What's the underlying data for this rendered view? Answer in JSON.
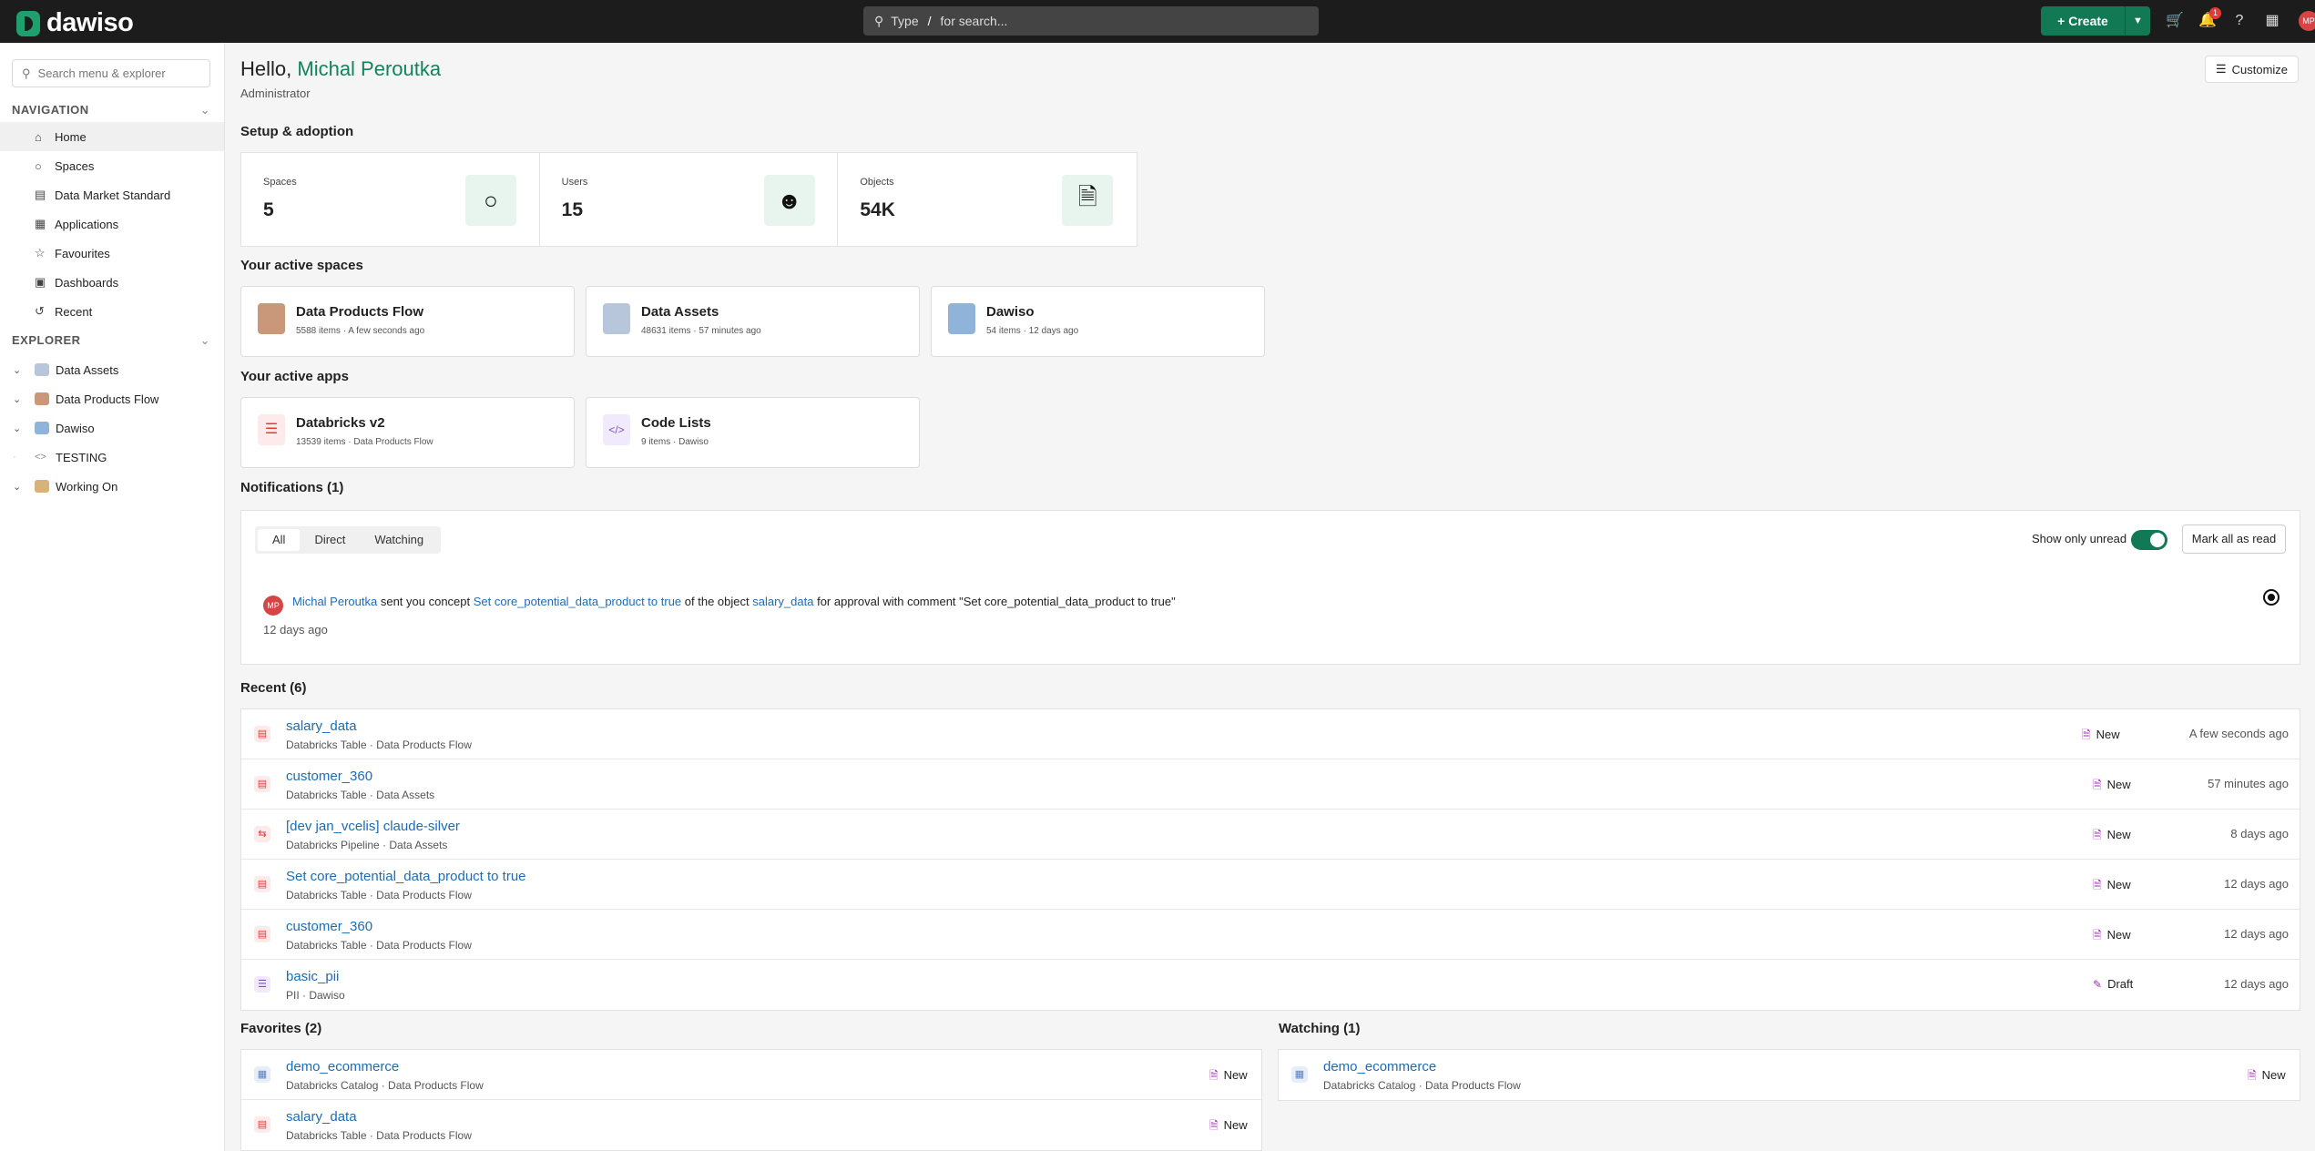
{
  "topbar": {
    "logo": "dawiso",
    "search_type": "Type",
    "search_key": "/",
    "search_hint": "for search...",
    "create_label": "Create",
    "notification_count": "1",
    "avatar": "MP"
  },
  "sidebar": {
    "search_placeholder": "Search menu & explorer",
    "nav_title": "NAVIGATION",
    "nav": [
      {
        "label": "Home",
        "icon": "home-icon"
      },
      {
        "label": "Spaces",
        "icon": "circle-icon"
      },
      {
        "label": "Data Market Standard",
        "icon": "book-icon"
      },
      {
        "label": "Applications",
        "icon": "grid-icon"
      },
      {
        "label": "Favourites",
        "icon": "star-icon"
      },
      {
        "label": "Dashboards",
        "icon": "dashboard-icon"
      },
      {
        "label": "Recent",
        "icon": "history-icon"
      }
    ],
    "explorer_title": "EXPLORER",
    "explorer": [
      {
        "label": "Data Assets"
      },
      {
        "label": "Data Products Flow"
      },
      {
        "label": "Dawiso"
      },
      {
        "label": "TESTING"
      },
      {
        "label": "Working On"
      }
    ]
  },
  "main": {
    "greeting": "Hello,",
    "user_name": "Michal Peroutka",
    "role": "Administrator",
    "customize": "Customize",
    "setup_title": "Setup & adoption",
    "stats": [
      {
        "label": "Spaces",
        "value": "5"
      },
      {
        "label": "Users",
        "value": "15"
      },
      {
        "label": "Objects",
        "value": "54K"
      }
    ],
    "spaces_title": "Your active spaces",
    "spaces": [
      {
        "title": "Data Products Flow",
        "sub": "5588 items · A few seconds ago"
      },
      {
        "title": "Data Assets",
        "sub": "48631 items · 57 minutes ago"
      },
      {
        "title": "Dawiso",
        "sub": "54 items · 12 days ago"
      }
    ],
    "apps_title": "Your active apps",
    "apps": [
      {
        "title": "Databricks v2",
        "sub": "13539 items · Data Products Flow"
      },
      {
        "title": "Code Lists",
        "sub": "9 items · Dawiso"
      }
    ],
    "notifications_title": "Notifications (1)",
    "notif_tabs": [
      "All",
      "Direct",
      "Watching"
    ],
    "show_unread": "Show only unread",
    "mark_all": "Mark all as read",
    "notification": {
      "avatar": "MP",
      "sender": "Michal Peroutka",
      "t1": "sent you concept",
      "concept": "Set core_potential_data_product to true",
      "t2": "of the object",
      "object": "salary_data",
      "t3": "for approval with comment \"Set core_potential_data_product to true\"",
      "time": "12 days ago"
    },
    "recent_title": "Recent (6)",
    "recent": [
      {
        "title": "salary_data",
        "sub": "Databricks Table · Data Products Flow",
        "status": "New",
        "time": "A few seconds ago"
      },
      {
        "title": "customer_360",
        "sub": "Databricks Table · Data Assets",
        "status": "New",
        "time": "57 minutes ago"
      },
      {
        "title": "[dev jan_vcelis] claude-silver",
        "sub": "Databricks Pipeline · Data Assets",
        "status": "New",
        "time": "8 days ago"
      },
      {
        "title": "Set core_potential_data_product to true",
        "sub": "Databricks Table · Data Products Flow",
        "status": "New",
        "time": "12 days ago"
      },
      {
        "title": "customer_360",
        "sub": "Databricks Table · Data Products Flow",
        "status": "New",
        "time": "12 days ago"
      },
      {
        "title": "basic_pii",
        "sub": "PII · Dawiso",
        "status": "Draft",
        "time": "12 days ago"
      }
    ],
    "favorites_title": "Favorites (2)",
    "favorites": [
      {
        "title": "demo_ecommerce",
        "sub": "Databricks Catalog · Data Products Flow",
        "status": "New"
      },
      {
        "title": "salary_data",
        "sub": "Databricks Table · Data Products Flow",
        "status": "New"
      }
    ],
    "watching_title": "Watching (1)",
    "watching": [
      {
        "title": "demo_ecommerce",
        "sub": "Databricks Catalog · Data Products Flow",
        "status": "New"
      }
    ]
  }
}
